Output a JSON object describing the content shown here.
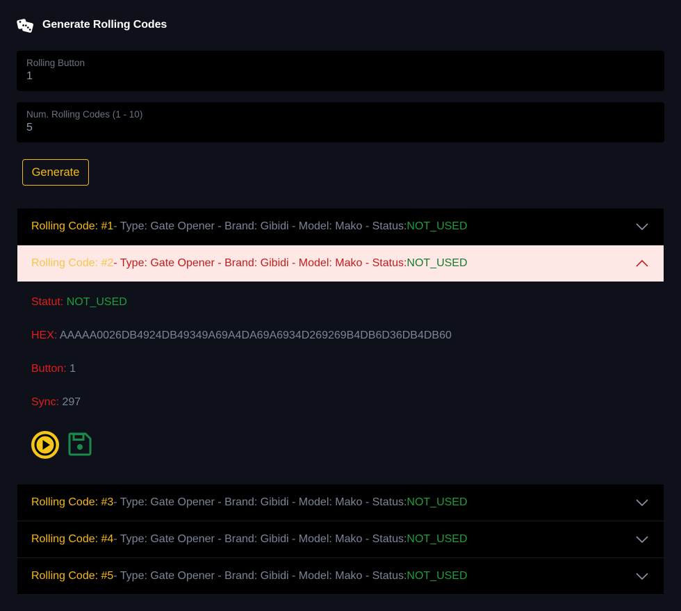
{
  "header": {
    "icon": "dice-icon",
    "title": "Generate Rolling Codes"
  },
  "form": {
    "rolling_button": {
      "label": "Rolling Button",
      "value": "1"
    },
    "num_codes": {
      "label": "Num. Rolling Codes (1 - 10)",
      "value": "5"
    },
    "generate_label": "Generate"
  },
  "colors": {
    "accent": "#f5b915",
    "error_label": "#e01e1e",
    "status_green": "#1f9d3a",
    "open_row_bg": "#fde8e6",
    "page_bg": "#0e1119"
  },
  "codes": [
    {
      "title": "Rolling Code: #1",
      "meta": "- Type: Gate Opener - Brand: Gibidi - Model: Mako - Status:",
      "status": "NOT_USED",
      "open": false
    },
    {
      "title": "Rolling Code: #2",
      "meta": "- Type: Gate Opener - Brand: Gibidi - Model: Mako - Status:",
      "status": "NOT_USED",
      "open": true
    },
    {
      "title": "Rolling Code: #3",
      "meta": "- Type: Gate Opener - Brand: Gibidi - Model: Mako - Status:",
      "status": "NOT_USED",
      "open": false
    },
    {
      "title": "Rolling Code: #4",
      "meta": "- Type: Gate Opener - Brand: Gibidi - Model: Mako - Status:",
      "status": "NOT_USED",
      "open": false
    },
    {
      "title": "Rolling Code: #5",
      "meta": "- Type: Gate Opener - Brand: Gibidi - Model: Mako - Status:",
      "status": "NOT_USED",
      "open": false
    }
  ],
  "detail": {
    "statut_label": "Statut:",
    "statut_value": "NOT_USED",
    "hex_label": "HEX:",
    "hex_value": "AAAAA0026DB4924DB49349A69A4DA69A6934D269269B4DB6D36DB4DB60",
    "button_label": "Button:",
    "button_value": "1",
    "sync_label": "Sync:",
    "sync_value": "297",
    "play_icon": "play-icon",
    "save_icon": "floppy-disk-icon"
  }
}
